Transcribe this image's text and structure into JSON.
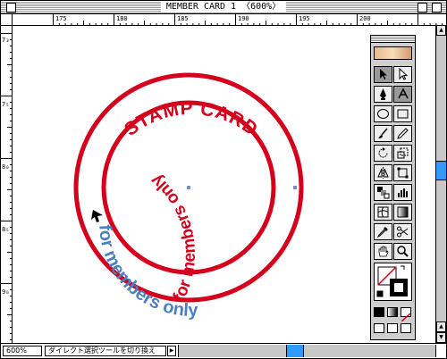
{
  "window": {
    "title": "MEMBER CARD 1 〈600%〉",
    "ruler_top_labels": [
      "175",
      "180",
      "185",
      "190",
      "195",
      "200"
    ],
    "ruler_left_labels": [
      "7₃",
      "7₅",
      "8₀",
      "8₅",
      "9₀"
    ]
  },
  "artwork": {
    "outer_text": "STAMP CARD",
    "lower_text": "for members only",
    "inverse_text": "for members only",
    "colors": {
      "stamp_red": "#d5001c",
      "text_blue": "#4a7fc1",
      "guide_blue": "#6f8fd0"
    }
  },
  "toolbox": {
    "tools": [
      {
        "name": "selection-tool",
        "icon": "arrow-icon"
      },
      {
        "name": "direct-selection-tool",
        "icon": "hollow-arrow-icon"
      },
      {
        "name": "pen-tool",
        "icon": "pen-icon"
      },
      {
        "name": "type-tool",
        "icon": "text-icon"
      },
      {
        "name": "ellipse-tool",
        "icon": "ellipse-icon"
      },
      {
        "name": "rectangle-tool",
        "icon": "rectangle-icon"
      },
      {
        "name": "brush-tool",
        "icon": "brush-icon"
      },
      {
        "name": "pencil-tool",
        "icon": "pencil-icon"
      },
      {
        "name": "rotate-tool",
        "icon": "rotate-icon"
      },
      {
        "name": "scale-tool",
        "icon": "scale-icon"
      },
      {
        "name": "reflect-tool",
        "icon": "reflect-icon"
      },
      {
        "name": "free-transform-tool",
        "icon": "transform-icon"
      },
      {
        "name": "blend-tool",
        "icon": "blend-icon"
      },
      {
        "name": "graph-tool",
        "icon": "graph-icon"
      },
      {
        "name": "gradient-mesh-tool",
        "icon": "mesh-icon"
      },
      {
        "name": "gradient-tool",
        "icon": "gradient-icon"
      },
      {
        "name": "eyedropper-tool",
        "icon": "eyedropper-icon"
      },
      {
        "name": "scissors-tool",
        "icon": "scissors-icon"
      },
      {
        "name": "hand-tool",
        "icon": "hand-icon"
      },
      {
        "name": "zoom-tool",
        "icon": "magnifier-icon"
      }
    ]
  },
  "status": {
    "zoom": "600%",
    "text": "ダイレクト選択ツールを切り換え"
  }
}
